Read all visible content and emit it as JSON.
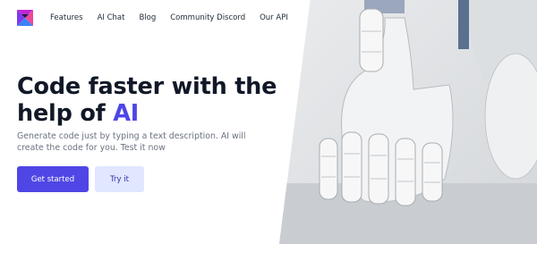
{
  "nav": {
    "logo_icon": "triangle-mosaic-logo",
    "links": [
      "Features",
      "AI Chat",
      "Blog",
      "Community Discord",
      "Our API"
    ]
  },
  "hero": {
    "title_prefix": "Code faster with the help of",
    "title_accent": "AI",
    "description": "Generate code just by typing a text description. AI will create the code for you. Test it now",
    "primary_button": "Get started",
    "secondary_button": "Try it",
    "image": "robot-hand-photo"
  },
  "colors": {
    "accent": "#4f46e5",
    "secondary_button_bg": "#e0e7ff",
    "heading": "#111827",
    "body_text": "#6b7280"
  }
}
